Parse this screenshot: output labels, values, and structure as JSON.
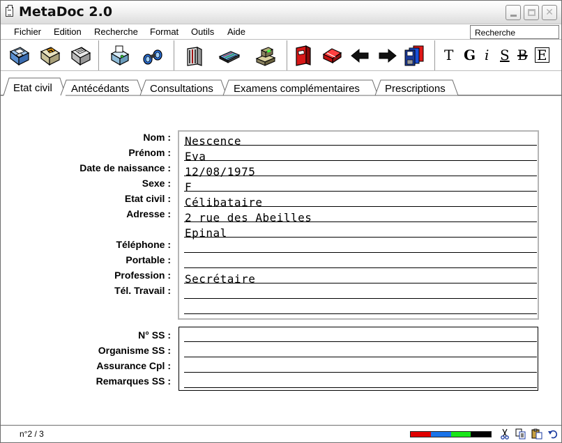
{
  "window": {
    "title": "MetaDoc 2.0"
  },
  "menu": {
    "items": [
      "Fichier",
      "Edition",
      "Recherche",
      "Format",
      "Outils",
      "Aide"
    ],
    "search_value": "Recherche"
  },
  "toolbar": {
    "icons": [
      "save-floppy-icon",
      "open-floppy-icon",
      "print-floppy-icon",
      "print-preview-icon",
      "binoculars-icon",
      "address-book-icon",
      "keyboard-icon",
      "cash-register-icon",
      "red-book-icon",
      "eraser-icon",
      "arrow-left-icon",
      "arrow-right-icon",
      "floppy-stack-icon"
    ],
    "format_buttons": [
      "T",
      "G",
      "i",
      "S",
      "B",
      "E"
    ]
  },
  "tabs": [
    {
      "label": "Etat civil",
      "active": true
    },
    {
      "label": "Antécédants",
      "active": false
    },
    {
      "label": "Consultations",
      "active": false
    },
    {
      "label": "Examens complémentaires",
      "active": false
    },
    {
      "label": "Prescriptions",
      "active": false
    }
  ],
  "identity": {
    "labels": {
      "nom": "Nom :",
      "prenom": "Prénom :",
      "naissance": "Date de naissance :",
      "sexe": "Sexe :",
      "etat_civil": "Etat civil :",
      "adresse": "Adresse :",
      "telephone": "Téléphone :",
      "portable": "Portable :",
      "profession": "Profession :",
      "tel_travail": "Tél. Travail :"
    },
    "values": {
      "nom": "Nescence",
      "prenom": "Eva",
      "naissance": "12/08/1975",
      "sexe": "F",
      "etat_civil": "Célibataire",
      "adresse_1": "2 rue des Abeilles",
      "adresse_2": "Epinal",
      "telephone": "",
      "portable": "",
      "profession": "Secrétaire",
      "tel_travail": "",
      "tel_travail_2": ""
    }
  },
  "securite_sociale": {
    "labels": {
      "numero": "N° SS :",
      "organisme": "Organisme SS :",
      "assurance": "Assurance Cpl :",
      "remarques": "Remarques SS :"
    },
    "values": {
      "numero": "",
      "organisme": "",
      "assurance": "",
      "remarques": ""
    }
  },
  "status": {
    "record": "n°2 / 3",
    "colors": [
      "#e00000",
      "#1a73e8",
      "#19e619",
      "#000000"
    ],
    "icons": [
      "scissors-icon",
      "copy-icon",
      "paste-icon",
      "undo-icon"
    ]
  }
}
